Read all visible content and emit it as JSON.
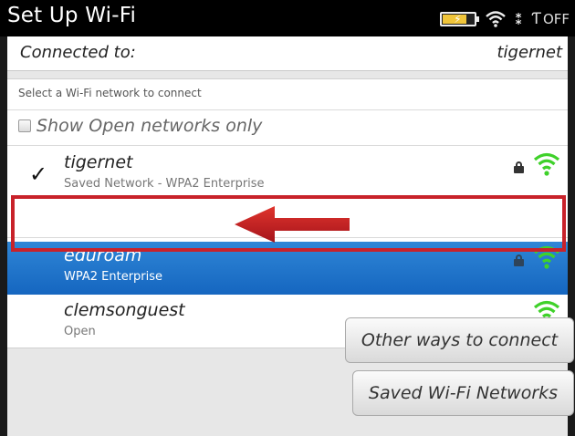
{
  "title_bar": {
    "title": "Set Up Wi-Fi",
    "status_text": "OFF"
  },
  "connected": {
    "label": "Connected to:",
    "value": "tigernet"
  },
  "network_list": {
    "section_label": "Select a Wi-Fi network to connect",
    "open_only_label": "Show Open networks only",
    "open_only_checked": false,
    "networks": [
      {
        "name": "tigernet",
        "sub": "Saved Network - WPA2 Enterprise",
        "connected": true,
        "locked": true,
        "selected": false
      },
      {
        "name": "eduroam",
        "sub": "WPA2 Enterprise",
        "connected": false,
        "locked": true,
        "selected": true
      },
      {
        "name": "clemsonguest",
        "sub": "Open",
        "connected": false,
        "locked": false,
        "selected": false
      }
    ]
  },
  "buttons": {
    "other_ways": "Other ways to connect",
    "saved_networks": "Saved Wi-Fi Networks"
  },
  "colors": {
    "selection": "#1e74cc",
    "highlight_border": "#c8222a",
    "wifi_green": "#3fd12a"
  },
  "icons": [
    "battery-icon",
    "wifi-icon",
    "bluetooth-icon",
    "antenna-icon",
    "checkmark-icon",
    "lock-icon",
    "wifi-signal-icon",
    "arrow-icon"
  ]
}
